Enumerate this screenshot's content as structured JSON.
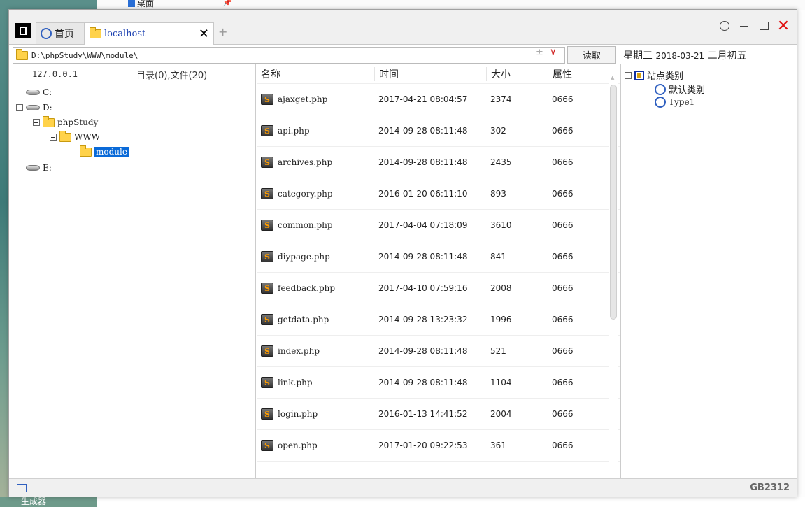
{
  "desktop": {
    "top_item": "桌面",
    "bottom_item": "生成器"
  },
  "tabs": [
    {
      "label": "首页"
    },
    {
      "label": "localhost"
    }
  ],
  "window_controls": {
    "close": "✕"
  },
  "address": {
    "path": "D:\\phpStudy\\WWW\\module\\",
    "plus": "±",
    "dropdown": "∨",
    "read_button": "读取"
  },
  "date": {
    "weekday": "星期三",
    "date": "2018-03-21",
    "lunar": "二月初五"
  },
  "left_panel": {
    "ip": "127.0.0.1",
    "summary": "目录(0),文件(20)",
    "tree": [
      {
        "label": "C:"
      },
      {
        "label": "D:"
      },
      {
        "label": "phpStudy"
      },
      {
        "label": "WWW"
      },
      {
        "label": "module"
      },
      {
        "label": "E:"
      }
    ]
  },
  "file_list": {
    "headers": {
      "name": "名称",
      "time": "时间",
      "size": "大小",
      "attr": "属性"
    },
    "rows": [
      {
        "name": "ajaxget.php",
        "time": "2017-04-21 08:04:57",
        "size": "2374",
        "attr": "0666"
      },
      {
        "name": "api.php",
        "time": "2014-09-28 08:11:48",
        "size": "302",
        "attr": "0666"
      },
      {
        "name": "archives.php",
        "time": "2014-09-28 08:11:48",
        "size": "2435",
        "attr": "0666"
      },
      {
        "name": "category.php",
        "time": "2016-01-20 06:11:10",
        "size": "893",
        "attr": "0666"
      },
      {
        "name": "common.php",
        "time": "2017-04-04 07:18:09",
        "size": "3610",
        "attr": "0666"
      },
      {
        "name": "diypage.php",
        "time": "2014-09-28 08:11:48",
        "size": "841",
        "attr": "0666"
      },
      {
        "name": "feedback.php",
        "time": "2017-04-10 07:59:16",
        "size": "2008",
        "attr": "0666"
      },
      {
        "name": "getdata.php",
        "time": "2014-09-28 13:23:32",
        "size": "1996",
        "attr": "0666"
      },
      {
        "name": "index.php",
        "time": "2014-09-28 08:11:48",
        "size": "521",
        "attr": "0666"
      },
      {
        "name": "link.php",
        "time": "2014-09-28 08:11:48",
        "size": "1104",
        "attr": "0666"
      },
      {
        "name": "login.php",
        "time": "2016-01-13 14:41:52",
        "size": "2004",
        "attr": "0666"
      },
      {
        "name": "open.php",
        "time": "2017-01-20 09:22:53",
        "size": "361",
        "attr": "0666"
      }
    ]
  },
  "right_panel": {
    "root": "站点类别",
    "items": [
      {
        "label": "默认类别"
      },
      {
        "label": "Type1"
      }
    ]
  },
  "status": {
    "encoding": "GB2312"
  }
}
